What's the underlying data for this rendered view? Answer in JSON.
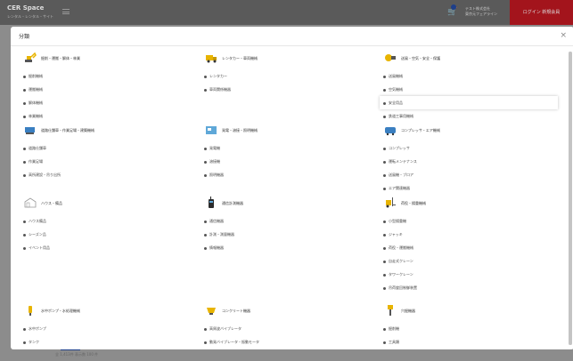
{
  "app": {
    "brand": "CER Space",
    "brand_sub": "レンタル・レンタル・サイト",
    "company": [
      "テスト株式会社",
      "東京元フェアライン"
    ],
    "login_label": "ログイン 新規会員",
    "bottom_text": "全 1,413件 表示数 100 件"
  },
  "modal": {
    "title": "分類",
    "close_label": "×"
  },
  "columns": [
    {
      "groups": [
        {
          "label": "掘削・運搬・解体・林業",
          "icon": "excavator-icon",
          "items": [
            "掘削機械",
            "運搬機械",
            "解体機械",
            "林業機械"
          ]
        },
        {
          "label": "道路仕舗車・作業足場・建築機械",
          "icon": "paver-icon",
          "items": [
            "道路仕舗車",
            "作業足場",
            "高所建設・吊り出所"
          ]
        },
        {
          "label": "ハウス・備品",
          "icon": "prefab-house-icon",
          "items": [
            "ハウス備品",
            "シーズン品",
            "イベント用品"
          ]
        },
        {
          "label": "水中ポンプ・水処理機械",
          "icon": "water-pump-icon",
          "items": [
            "水中ポンプ",
            "タンク"
          ]
        }
      ]
    },
    {
      "groups": [
        {
          "label": "レンタカー・車両機械",
          "icon": "truck-icon",
          "items": [
            "レンタカー",
            "車両関係機器"
          ]
        },
        {
          "label": "発電・溶接・照明機械",
          "icon": "generator-icon",
          "items": [
            "発電機",
            "溶接機",
            "照明機器"
          ]
        },
        {
          "label": "通信計測機器",
          "icon": "radio-icon",
          "items": [
            "通信機器",
            "計測・測量機器",
            "情報機器"
          ]
        },
        {
          "label": "コンクリート機器",
          "icon": "concrete-mixer-icon",
          "items": [
            "高周波バイブレータ",
            "動発バイブレータ・振動モータ"
          ]
        }
      ]
    },
    {
      "groups": [
        {
          "label": "送風・空気・安全・保護",
          "icon": "blower-icon",
          "items": [
            "送風機械",
            "空気機械",
            "安全用品",
            "鉄道工事用機械"
          ],
          "highlight_index": 2
        },
        {
          "label": "コンプレッサ・エア機械",
          "icon": "compressor-icon",
          "items": [
            "コンプレッサ",
            "運転メンテナンス",
            "送風機・ブロア",
            "エア関連機器"
          ]
        },
        {
          "label": "荷役・揚重機械",
          "icon": "forklift-icon",
          "items": [
            "小型揚重機",
            "ジャッキ",
            "荷役・運搬機械",
            "自走式クレーン",
            "タワークレーン",
            "吊荷旋回制御装置"
          ]
        },
        {
          "label": "穴掘機器",
          "icon": "drill-icon",
          "items": [
            "掘削機",
            "工具類"
          ]
        }
      ]
    }
  ]
}
